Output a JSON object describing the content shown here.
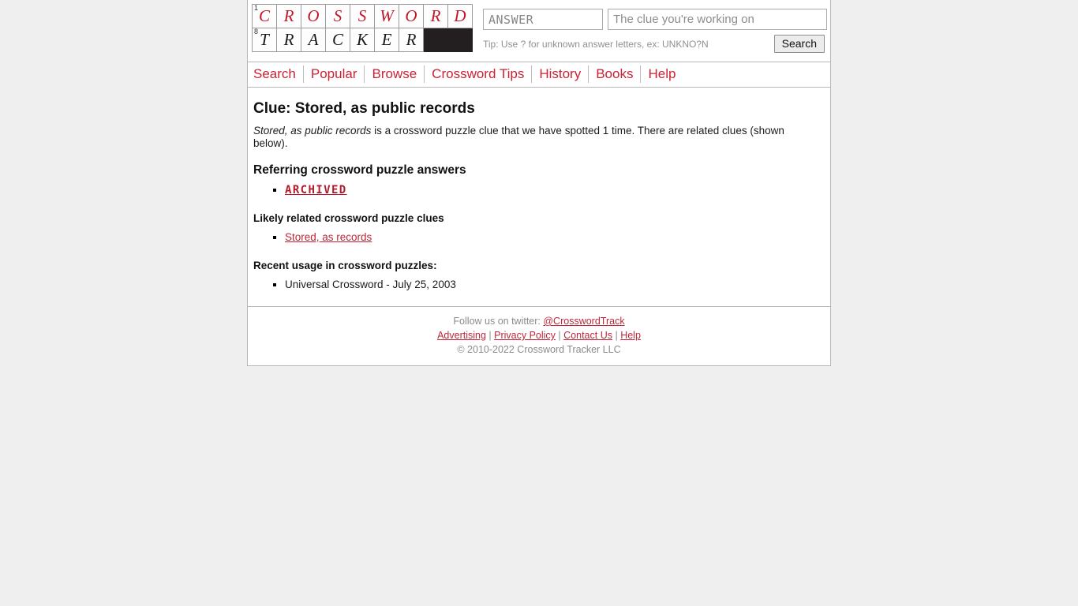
{
  "logo": {
    "across": {
      "number": "1",
      "letters": [
        "C",
        "R",
        "O",
        "S",
        "S",
        "W",
        "O",
        "R",
        "D"
      ]
    },
    "down": {
      "number": "8",
      "letters": [
        "T",
        "R",
        "A",
        "C",
        "K",
        "E",
        "R"
      ],
      "blanks": 2
    },
    "across_color": "#c0182b",
    "down_color": "#1a1a1a"
  },
  "search": {
    "answer_placeholder": "ANSWER",
    "answer_value": "",
    "clue_placeholder": "The clue you're working on",
    "clue_value": "",
    "tip": "Tip: Use ? for unknown answer letters, ex: UNKNO?N",
    "button_label": "Search"
  },
  "nav": {
    "items": [
      {
        "label": "Search"
      },
      {
        "label": "Popular"
      },
      {
        "label": "Browse"
      },
      {
        "label": "Crossword Tips"
      },
      {
        "label": "History"
      },
      {
        "label": "Books"
      },
      {
        "label": "Help"
      }
    ],
    "link_color": "#cc2233"
  },
  "main": {
    "title": "Clue: Stored, as public records",
    "intro_clue": "Stored, as public records",
    "intro_rest": " is a crossword puzzle clue that we have spotted 1 time. There are related clues (shown below).",
    "answers_heading": "Referring crossword puzzle answers",
    "answers": [
      {
        "label": "ARCHIVED"
      }
    ],
    "related_heading": "Likely related crossword puzzle clues",
    "related": [
      {
        "label": "Stored, as records"
      }
    ],
    "usage_heading": "Recent usage in crossword puzzles:",
    "usage": [
      {
        "label": "Universal Crossword - July 25, 2003"
      }
    ]
  },
  "footer": {
    "twitter_prefix": "Follow us on twitter: ",
    "twitter_handle": "@CrosswordTrack",
    "links": [
      {
        "label": "Advertising"
      },
      {
        "label": "Privacy Policy"
      },
      {
        "label": "Contact Us"
      },
      {
        "label": "Help"
      }
    ],
    "separator": " | ",
    "copyright": "© 2010-2022 Crossword Tracker LLC"
  }
}
